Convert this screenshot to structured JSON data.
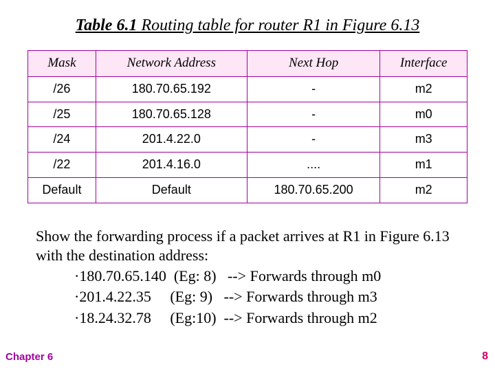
{
  "title": {
    "label": "Table 6.1",
    "rest": "  Routing table for router R1 in Figure 6.13"
  },
  "table": {
    "headers": [
      "Mask",
      "Network Address",
      "Next Hop",
      "Interface"
    ],
    "rows": [
      {
        "mask": "/26",
        "net": "180.70.65.192",
        "hop": "-",
        "iface": "m2"
      },
      {
        "mask": "/25",
        "net": "180.70.65.128",
        "hop": "-",
        "iface": "m0"
      },
      {
        "mask": "/24",
        "net": "201.4.22.0",
        "hop": "-",
        "iface": "m3"
      },
      {
        "mask": "/22",
        "net": "201.4.16.0",
        "hop": "....",
        "iface": "m1"
      },
      {
        "mask": "Default",
        "net": "Default",
        "hop": "180.70.65.200",
        "iface": "m2"
      }
    ]
  },
  "body": {
    "lead": "Show the forwarding process if a packet arrives at R1 in Figure 6.13 with the destination address:",
    "lines": [
      "·180.70.65.140  (Eg: 8)   --> Forwards through m0",
      "·201.4.22.35     (Eg: 9)   --> Forwards through m3",
      "·18.24.32.78     (Eg:10)  --> Forwards through m2"
    ]
  },
  "footer": {
    "left": "Chapter 6",
    "right": "8"
  },
  "chart_data": {
    "type": "table",
    "title": "Table 6.1  Routing table for router R1 in Figure 6.13",
    "columns": [
      "Mask",
      "Network Address",
      "Next Hop",
      "Interface"
    ],
    "rows": [
      [
        "/26",
        "180.70.65.192",
        "-",
        "m2"
      ],
      [
        "/25",
        "180.70.65.128",
        "-",
        "m0"
      ],
      [
        "/24",
        "201.4.22.0",
        "-",
        "m3"
      ],
      [
        "/22",
        "201.4.16.0",
        "....",
        "m1"
      ],
      [
        "Default",
        "Default",
        "180.70.65.200",
        "m2"
      ]
    ]
  }
}
